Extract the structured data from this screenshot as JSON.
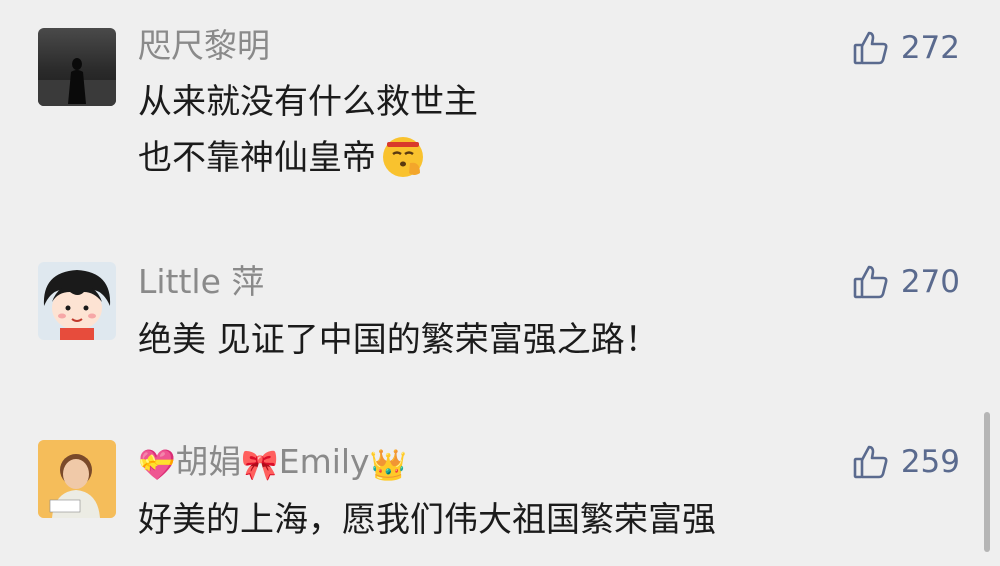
{
  "comments": [
    {
      "user": "咫尺黎明",
      "lines": [
        "从来就没有什么救世主",
        "也不靠神仙皇帝"
      ],
      "emoji_icon": "salute-face-emoji",
      "likes": "272"
    },
    {
      "user": "Little 萍",
      "lines": [
        "绝美 见证了中国的繁荣富强之路！"
      ],
      "likes": "270"
    },
    {
      "user_parts": [
        "💝",
        "胡娟",
        "🎀",
        "Emily",
        "👑"
      ],
      "lines": [
        "好美的上海，愿我们伟大祖国繁荣富强"
      ],
      "likes": "259"
    }
  ],
  "colors": {
    "background": "#efefef",
    "username": "#8a8a8a",
    "text": "#1b1b1b",
    "like": "#5a6a8e"
  },
  "icons": [
    "thumbs-up-icon",
    "avatar-image"
  ]
}
